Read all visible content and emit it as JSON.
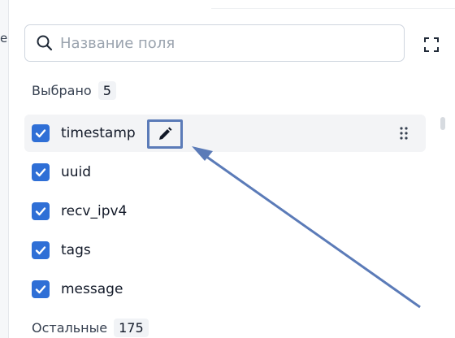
{
  "background": {
    "left_sliver_text": "e"
  },
  "search": {
    "placeholder": "Название поля",
    "value": "",
    "icon": "search-icon"
  },
  "expand_icon": "expand-icon",
  "selected_section": {
    "label": "Выбрано",
    "count": "5"
  },
  "fields": [
    {
      "name": "timestamp",
      "checked": true
    },
    {
      "name": "uuid",
      "checked": true
    },
    {
      "name": "recv_ipv4",
      "checked": true
    },
    {
      "name": "tags",
      "checked": true
    },
    {
      "name": "message",
      "checked": true
    }
  ],
  "other_section": {
    "label": "Остальные",
    "count": "175"
  },
  "colors": {
    "checkbox": "#2f6fd6",
    "annotation": "#5b7bb8",
    "hover_row": "#f3f4f6"
  }
}
